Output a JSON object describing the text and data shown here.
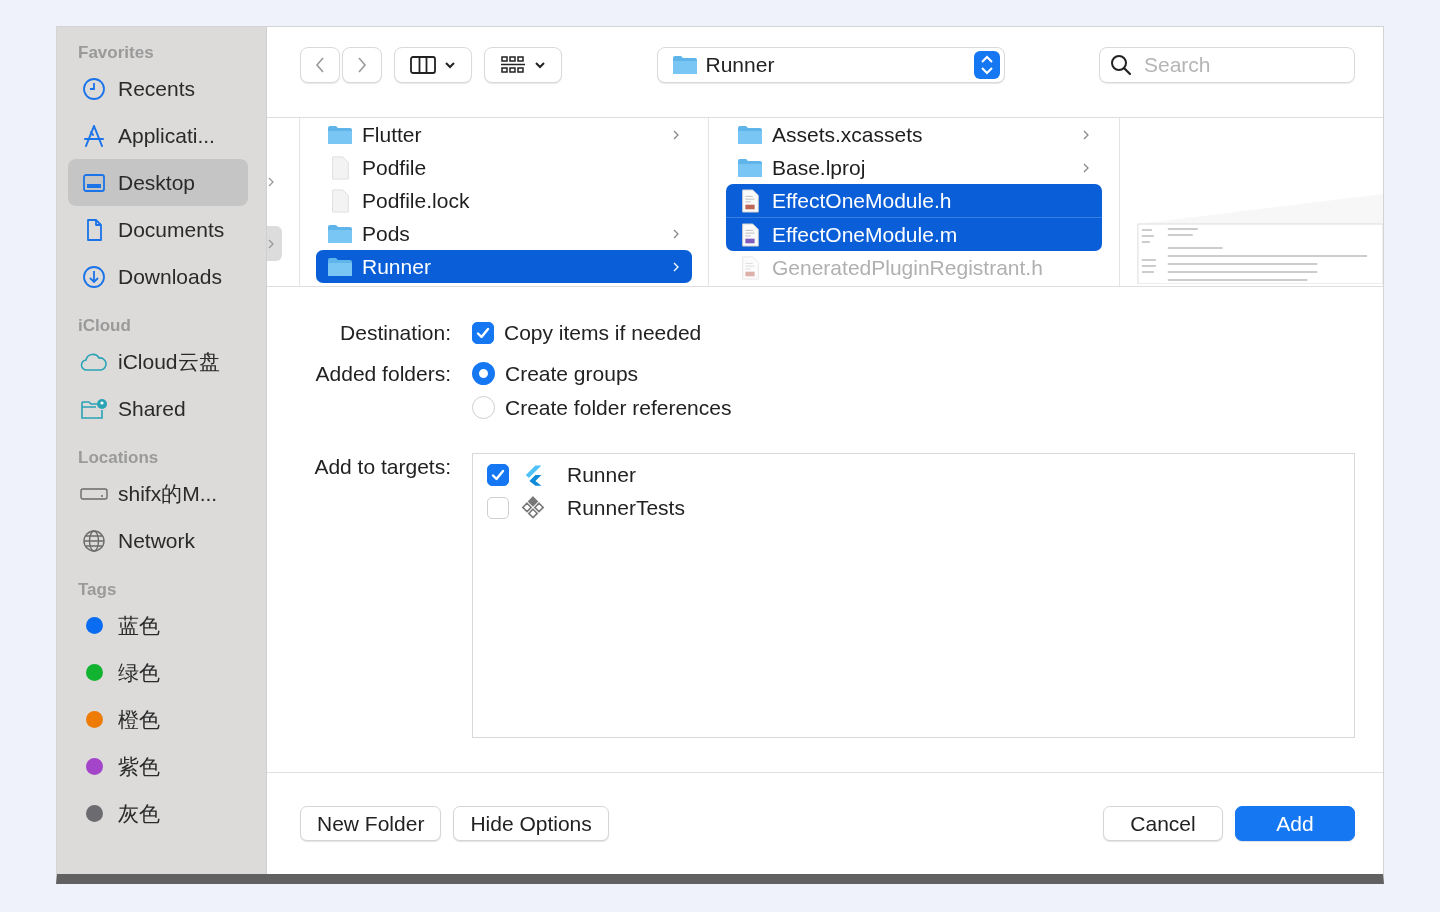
{
  "sidebar": {
    "sections": [
      {
        "heading": "Favorites",
        "items": [
          {
            "label": "Recents",
            "kind": "clock",
            "selected": false
          },
          {
            "label": "Applicati...",
            "kind": "apps",
            "selected": false
          },
          {
            "label": "Desktop",
            "kind": "desktop",
            "selected": true
          },
          {
            "label": "Documents",
            "kind": "document",
            "selected": false
          },
          {
            "label": "Downloads",
            "kind": "download",
            "selected": false
          }
        ]
      },
      {
        "heading": "iCloud",
        "items": [
          {
            "label": "iCloud云盘",
            "kind": "cloud",
            "selected": false
          },
          {
            "label": "Shared",
            "kind": "shared",
            "selected": false
          }
        ]
      },
      {
        "heading": "Locations",
        "items": [
          {
            "label": "shifx的M...",
            "kind": "disk",
            "selected": false
          },
          {
            "label": "Network",
            "kind": "globe",
            "selected": false
          }
        ]
      },
      {
        "heading": "Tags",
        "items": [
          {
            "label": "蓝色",
            "kind": "tag",
            "color": "#0a6cf0",
            "selected": false
          },
          {
            "label": "绿色",
            "kind": "tag",
            "color": "#12b331",
            "selected": false
          },
          {
            "label": "橙色",
            "kind": "tag",
            "color": "#ee7b06",
            "selected": false
          },
          {
            "label": "紫色",
            "kind": "tag",
            "color": "#a445c9",
            "selected": false
          },
          {
            "label": "灰色",
            "kind": "tag",
            "color": "#6c6c70",
            "selected": false
          }
        ]
      }
    ]
  },
  "toolbar": {
    "location": "Runner",
    "search_placeholder": "Search"
  },
  "columns": [
    {
      "items": [
        {
          "name": "Flutter",
          "kind": "folder",
          "expandable": true,
          "selected": false,
          "disabled": false
        },
        {
          "name": "Podfile",
          "kind": "file",
          "expandable": false,
          "selected": false,
          "disabled": false
        },
        {
          "name": "Podfile.lock",
          "kind": "file",
          "expandable": false,
          "selected": false,
          "disabled": false
        },
        {
          "name": "Pods",
          "kind": "folder",
          "expandable": true,
          "selected": false,
          "disabled": false
        },
        {
          "name": "Runner",
          "kind": "folder",
          "expandable": true,
          "selected": true,
          "disabled": false
        }
      ]
    },
    {
      "items": [
        {
          "name": "Assets.xcassets",
          "kind": "folder",
          "expandable": true,
          "selected": false,
          "disabled": false
        },
        {
          "name": "Base.lproj",
          "kind": "folder",
          "expandable": true,
          "selected": false,
          "disabled": false
        },
        {
          "name": "EffectOneModule.h",
          "kind": "h",
          "expandable": false,
          "selected": true,
          "disabled": false
        },
        {
          "name": "EffectOneModule.m",
          "kind": "m",
          "expandable": false,
          "selected": true,
          "disabled": false
        },
        {
          "name": "GeneratedPluginRegistrant.h",
          "kind": "h",
          "expandable": false,
          "selected": false,
          "disabled": true
        }
      ]
    }
  ],
  "options": {
    "destination": {
      "label": "Destination:",
      "option": "Copy items if needed",
      "checked": true
    },
    "added_folders": {
      "label": "Added folders:",
      "choices": [
        {
          "label": "Create groups",
          "selected": true
        },
        {
          "label": "Create folder references",
          "selected": false
        }
      ]
    },
    "targets": {
      "label": "Add to targets:",
      "items": [
        {
          "name": "Runner",
          "kind": "flutter",
          "checked": true
        },
        {
          "name": "RunnerTests",
          "kind": "tests",
          "checked": false
        }
      ]
    }
  },
  "buttons": {
    "left": [
      {
        "label": "New Folder",
        "kind": "plain"
      },
      {
        "label": "Hide Options",
        "kind": "plain"
      }
    ],
    "right": [
      {
        "label": "Cancel",
        "kind": "plain"
      },
      {
        "label": "Add",
        "kind": "primary"
      }
    ]
  }
}
